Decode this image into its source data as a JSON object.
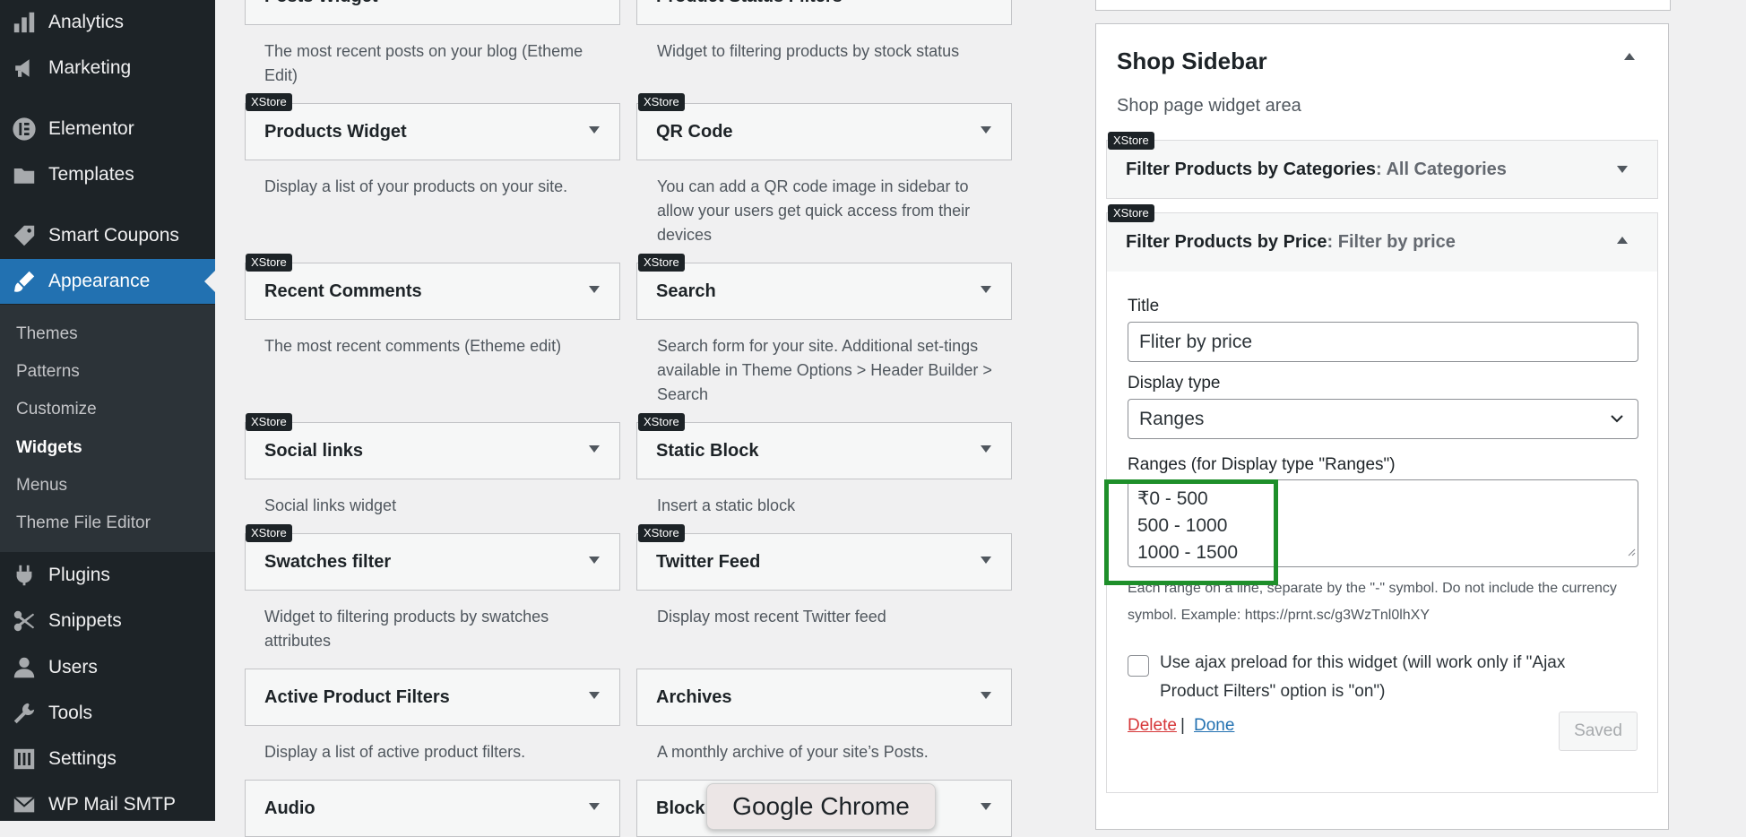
{
  "menu": {
    "items": [
      {
        "label": "Analytics",
        "icon": "bar-chart-icon"
      },
      {
        "label": "Marketing",
        "icon": "megaphone-icon"
      },
      {
        "label": "Elementor",
        "icon": "elementor-icon"
      },
      {
        "label": "Templates",
        "icon": "folder-icon"
      },
      {
        "label": "Smart Coupons",
        "icon": "tag-icon"
      },
      {
        "label": "Appearance",
        "icon": "brush-icon",
        "current": true
      },
      {
        "label": "Plugins",
        "icon": "plug-icon"
      },
      {
        "label": "Snippets",
        "icon": "scissors-icon"
      },
      {
        "label": "Users",
        "icon": "user-icon"
      },
      {
        "label": "Tools",
        "icon": "wrench-icon"
      },
      {
        "label": "Settings",
        "icon": "sliders-icon"
      },
      {
        "label": "WP Mail SMTP",
        "icon": "mail-icon"
      }
    ],
    "submenu": [
      "Themes",
      "Patterns",
      "Customize",
      "Widgets",
      "Menus",
      "Theme File Editor"
    ],
    "active_submenu": "Widgets"
  },
  "widgets": [
    {
      "title": "Posts Widget",
      "badge": "",
      "desc": "The most recent posts on your blog (Etheme Edit)"
    },
    {
      "title": "Product Status Filters",
      "badge": "",
      "desc": "Widget to filtering products by stock status"
    },
    {
      "title": "Products Widget",
      "badge": "XStore",
      "desc": "Display a list of your products on your site."
    },
    {
      "title": "QR Code",
      "badge": "XStore",
      "desc": "You can add a QR code image in sidebar to allow your users get quick access from their devices"
    },
    {
      "title": "Recent Comments",
      "badge": "XStore",
      "desc": "The most recent comments (Etheme edit)"
    },
    {
      "title": "Search",
      "badge": "XStore",
      "desc": "Search form for your site. Additional set-tings available in Theme Options > Header Builder > Search"
    },
    {
      "title": "Social links",
      "badge": "XStore",
      "desc": "Social links widget"
    },
    {
      "title": "Static Block",
      "badge": "XStore",
      "desc": "Insert a static block"
    },
    {
      "title": "Swatches filter",
      "badge": "XStore",
      "desc": "Widget to filtering products by swatches attributes"
    },
    {
      "title": "Twitter Feed",
      "badge": "XStore",
      "desc": "Display most recent Twitter feed"
    },
    {
      "title": "Active Product Filters",
      "badge": "",
      "desc": "Display a list of active product filters."
    },
    {
      "title": "Archives",
      "badge": "",
      "desc": "A monthly archive of your site’s Posts."
    },
    {
      "title": "Audio",
      "badge": "",
      "desc": ""
    },
    {
      "title": "Block",
      "badge": "",
      "desc": ""
    }
  ],
  "sidebar_panel": {
    "title": "Shop Sidebar",
    "description": "Shop page widget area",
    "widget1": {
      "badge": "XStore",
      "title": "Filter Products by Categories",
      "subtitle": ": All Categories"
    },
    "widget2": {
      "badge": "XStore",
      "title": "Filter Products by Price",
      "subtitle": ": Filter by price"
    },
    "form": {
      "title_label": "Title",
      "title_value": "Fliter by price",
      "display_label": "Display type",
      "display_value": "Ranges",
      "ranges_label": "Ranges (for Display type \"Ranges\")",
      "ranges": [
        "₹0 - 500",
        "500 - 1000",
        "1000 - 1500"
      ],
      "ranges_help": "Each range on a line, separate by the \"-\" symbol. Do not include the currency symbol. Example: https://prnt.sc/g3WzTnl0lhXY",
      "ajax_label": "Use ajax preload for this widget (will work only if \"Ajax Product Filters\" option is \"on\")",
      "delete_label": "Delete",
      "separator": "|",
      "done_label": "Done",
      "saved_label": "Saved"
    }
  },
  "tooltip": "Google Chrome",
  "colors": {
    "menu_bg": "#1d2327",
    "accent": "#2271b1",
    "highlight": "#1e8f2a",
    "delete": "#d63638"
  }
}
